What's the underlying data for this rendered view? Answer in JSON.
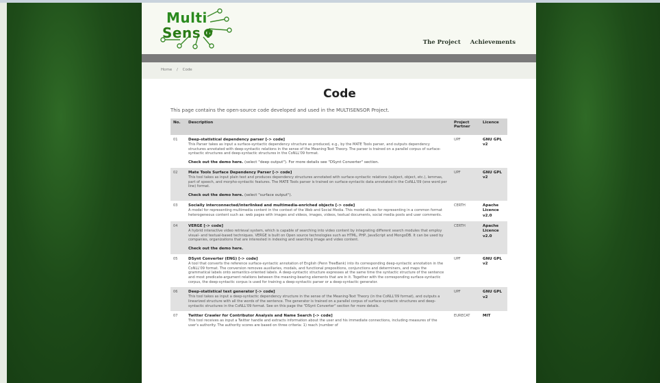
{
  "site": {
    "logo_line1": "Multi",
    "logo_line2": "Sens r",
    "nav": [
      "The Project",
      "Achievements"
    ]
  },
  "breadcrumb": [
    "Home",
    "/",
    "Code"
  ],
  "page": {
    "title": "Code",
    "intro": "This page contains the open-source code developed and used in the MULTISENSOR Project."
  },
  "table": {
    "headers": [
      "No.",
      "Description",
      "Project Partner",
      "Licence"
    ],
    "rows": [
      {
        "no": "01",
        "title": "Deep-statistical dependency parser [-> code]",
        "text": "This Parser takes as input a surface-syntactic dependency structure as produced, e.g., by the MATE Tools parser, and outputs dependency structures annotated with deep-syntactic relations in the sense of the Meaning-Text Theory. The parser is trained on a parallel corpus of surface-syntactic structures and deep-syntactic structures in the CoNLL'09 format.",
        "demo_link": "Check out the demo here.",
        "demo_note": " (select \"deep output\"). For more details see \"DSynt Converter\" section.",
        "partner": "UPF",
        "licence": "GNU GPL v2"
      },
      {
        "no": "02",
        "title": "Mate Tools Surface Dependency Parser [-> code]",
        "text": "This tool takes as input plain text and produces dependency structures annotated with surface-syntactic relations (subject, object, etc.), lemmas, part of speech, and morpho-syntactic features. The MATE Tools parser is trained on surface-syntactic data annotated in the CoNLL'09 (one word per line) format.",
        "demo_link": "Check out the demo here.",
        "demo_note": " (select \"surface output\").",
        "partner": "UPF",
        "licence": "GNU GPL v2"
      },
      {
        "no": "03",
        "title": "Socially interconnected/interlinked and multimedia-enriched objects [-> code]",
        "text": "A model for representing multimedia content in the context of the Web and Social Media. This model allows for representing in a common format heterogeneous content such as: web pages with images and videos, images, videos, textual documents, social media posts and user comments.",
        "demo_link": "",
        "demo_note": "",
        "partner": "CERTH",
        "licence": "Apache Licence v2.0"
      },
      {
        "no": "04",
        "title": "VERGE [-> code]",
        "text": "A hybrid interactive video retrieval system, which is capable of searching into video content by integrating different search modules that employ visual- and textual-based techniques. VERGE is built on Open source technologies such as HTML, PHP, JavaScript and MongoDB. It can be used by companies, organizations that are interested in indexing and searching image and video content.",
        "demo_link": "Check out the demo here.",
        "demo_note": "",
        "partner": "CERTH",
        "licence": "Apache Licence v2.0"
      },
      {
        "no": "05",
        "title": "DSynt Converter (ENG) [-> code]",
        "text": "A tool that converts the reference surface-syntactic annotation of English (Penn TreeBank) into its corresponding deep-syntactic annotation in the CoNLL'09 format. The conversion removes auxiliaries, modals, and functional prepositions, conjunctions and determiners, and maps the grammatical labels onto semantics-oriented labels. A deep-syntactic structure expresses at the same time the syntactic structure of the sentence and most predicate-argument relations between the meaning-bearing elements that are in it. Together with the corresponding surface-syntactic corpus, the deep-syntactic corpus is used for training a deep-syntactic parser or a deep-syntactic generator.",
        "demo_link": "",
        "demo_note": "",
        "partner": "UPF",
        "licence": "GNU GPL v2"
      },
      {
        "no": "06",
        "title": "Deep-statistical text generator [-> code]",
        "text": "This tool takes as input a deep-syntactic dependency structure in the sense of the Meaning-Text Theory (in the CoNLL'09 format), and outputs a linearized structure with all the words of the sentence. The generator is trained on a parallel corpus of surface-syntactic structures and deep-syntactic structures in the CoNLL'09 format. See on this page the \"DSynt Converter\" section for more details.",
        "demo_link": "",
        "demo_note": "",
        "partner": "UPF",
        "licence": "GNU GPL v2"
      },
      {
        "no": "07",
        "title": "Twitter Crawler for Contributor Analysis and Name Search [-> code]",
        "text": "This tool receives as input a Twitter handle and extracts information about the user and his immediate connections, including measures of the user's authority. The authority scores are based on three criteria: 1) reach (number of",
        "demo_link": "",
        "demo_note": "",
        "partner": "EURECAT",
        "licence": "MIT"
      }
    ]
  }
}
